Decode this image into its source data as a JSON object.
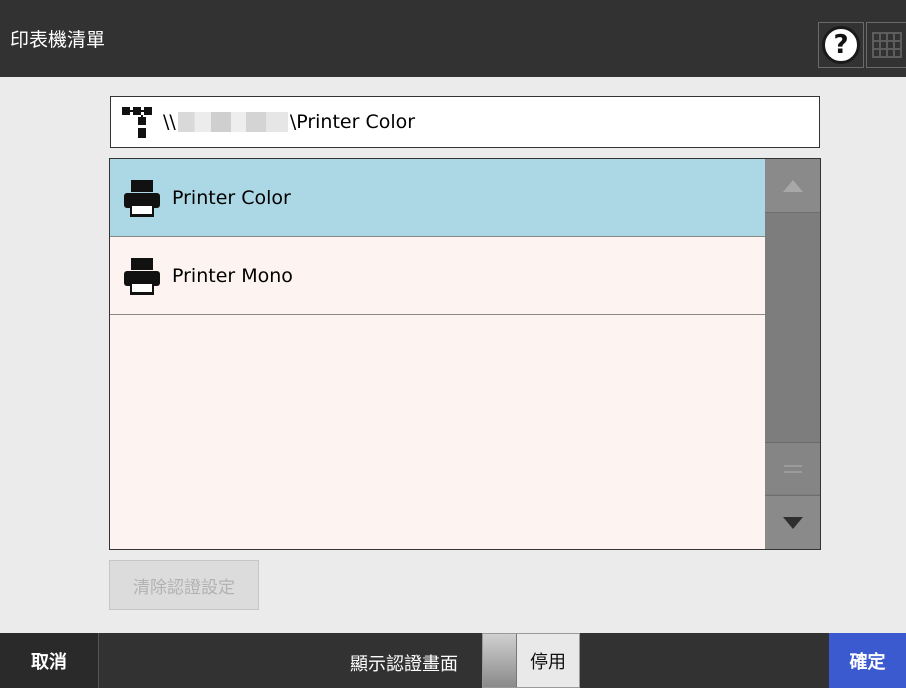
{
  "header": {
    "title": "印表機清單",
    "help_icon": "question-circle-icon",
    "keyboard_icon": "keyboard-icon"
  },
  "path_field": {
    "icon": "network-tree-icon",
    "prefix": "\\\\",
    "suffix": "\\Printer Color"
  },
  "printer_list": {
    "items": [
      {
        "label": "Printer Color",
        "icon": "printer-icon",
        "selected": true
      },
      {
        "label": "Printer Mono",
        "icon": "printer-icon",
        "selected": false
      }
    ],
    "scrollbar": {
      "up_icon": "triangle-up-icon",
      "down_icon": "triangle-down-icon",
      "thumb_icon": "grip-lines-icon"
    }
  },
  "clear_auth_button": {
    "label": "清除認證設定",
    "enabled": false
  },
  "footer": {
    "cancel_label": "取消",
    "show_auth_label": "顯示認證畫面",
    "toggle_state": "停用",
    "ok_label": "確定"
  },
  "colors": {
    "header_bg": "#323232",
    "selected_row": "#acd7e4",
    "list_bg": "#fdf3f0",
    "ok_button": "#3c5ad0"
  }
}
